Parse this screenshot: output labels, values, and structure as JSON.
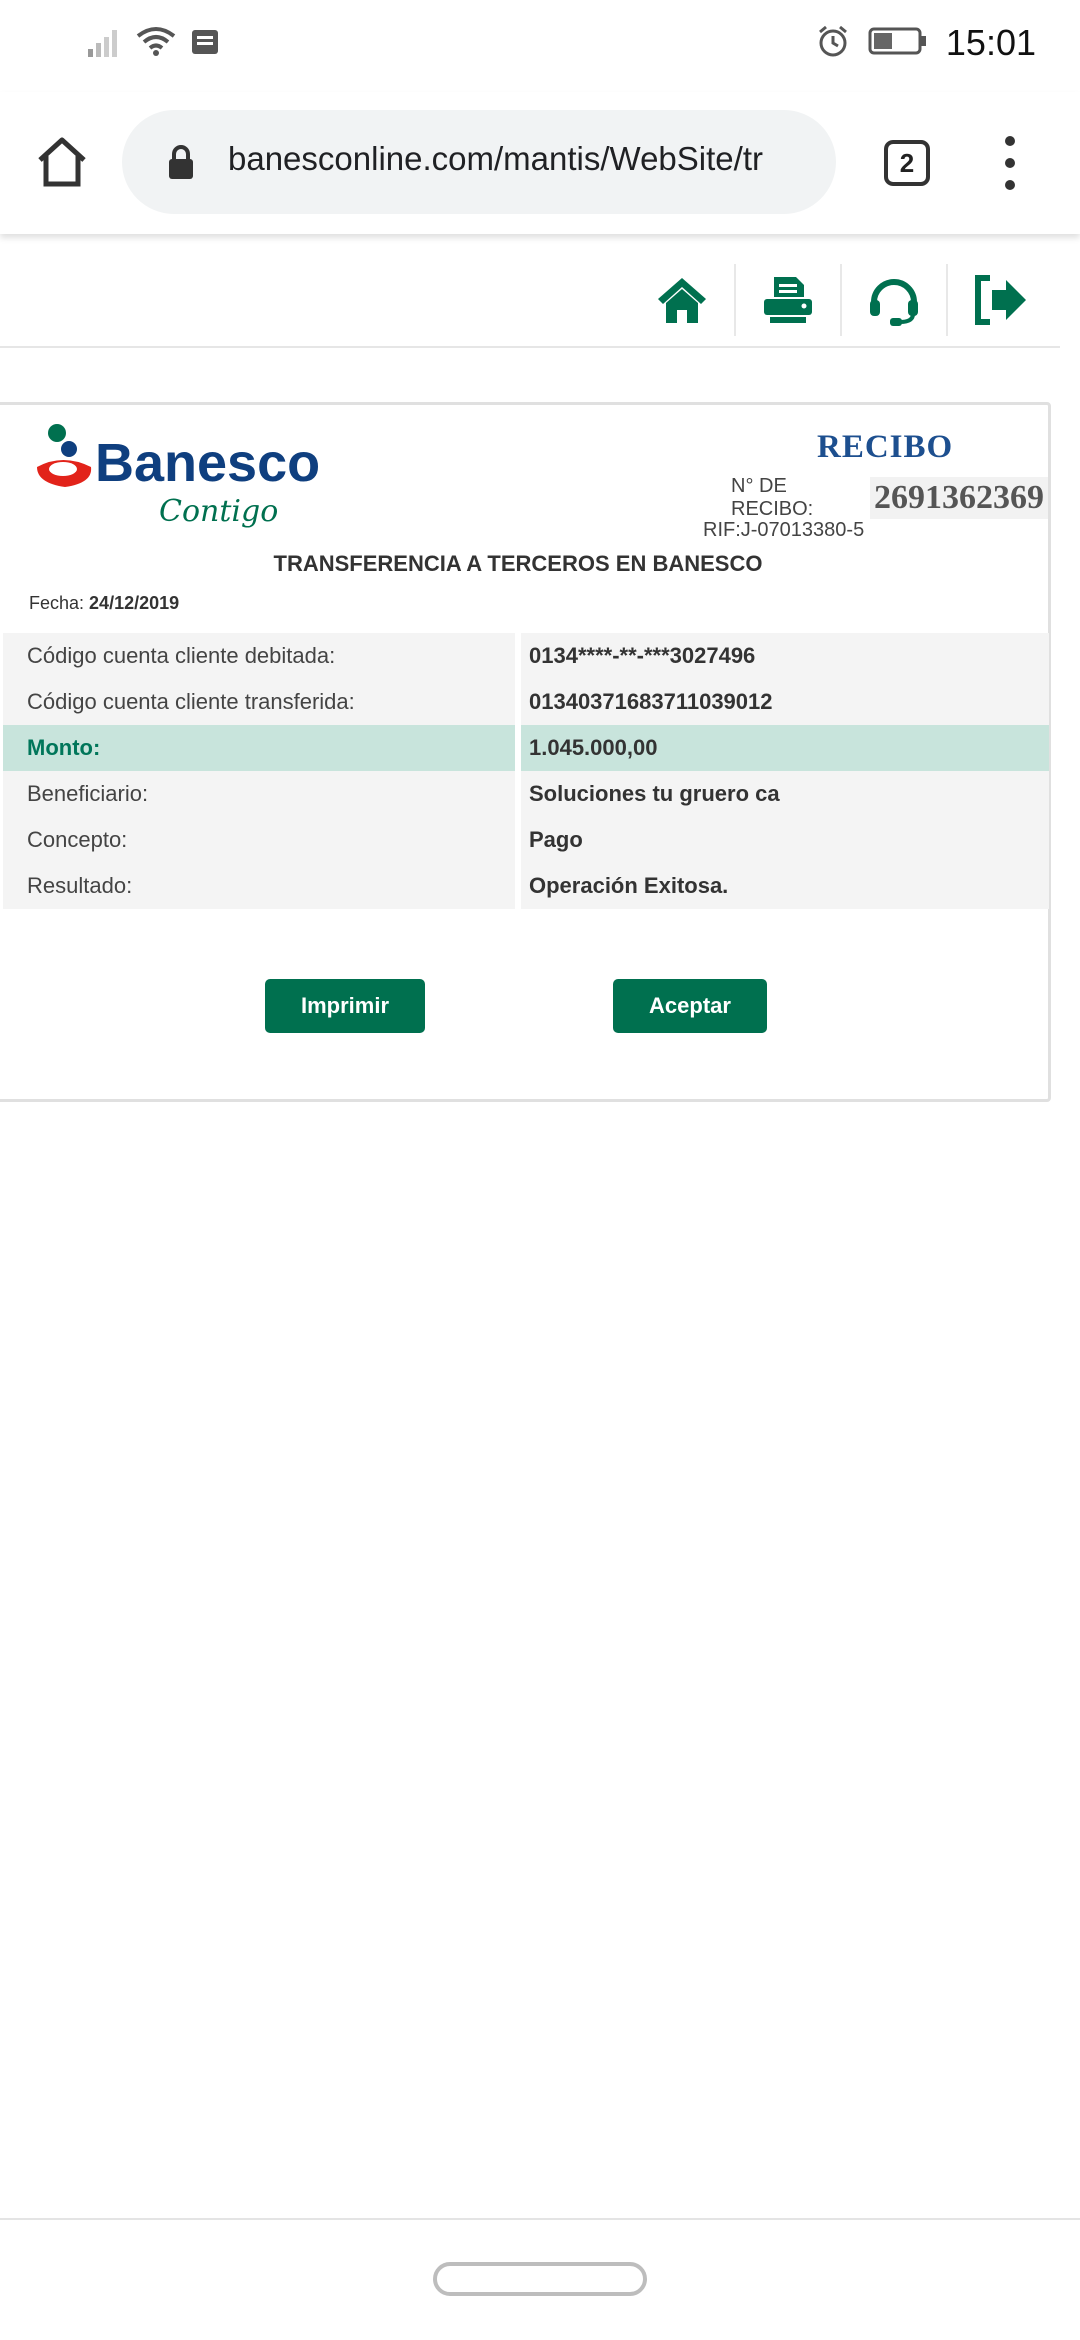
{
  "status_bar": {
    "time": "15:01",
    "icons": [
      "signal-icon",
      "wifi-icon",
      "notification-icon",
      "alarm-icon",
      "battery-icon"
    ]
  },
  "browser": {
    "url": "banesconline.com/mantis/WebSite/tr",
    "tab_count": "2",
    "icons": [
      "home-icon",
      "lock-icon",
      "menu-icon"
    ]
  },
  "toolbar": {
    "icons": [
      "home-icon",
      "printer-icon",
      "support-headset-icon",
      "logout-icon"
    ],
    "accent_color": "#00704f"
  },
  "receipt": {
    "bank_name": "Banesco",
    "bank_tagline": "Contigo",
    "title": "RECIBO",
    "number_label": "N° DE RECIBO:",
    "number": "2691362369",
    "rif": "RIF:J-07013380-5",
    "transaction_title": "TRANSFERENCIA A TERCEROS EN BANESCO",
    "date_label": "Fecha:",
    "date": "24/12/2019",
    "rows": [
      {
        "label": "Código cuenta cliente debitada:",
        "value": "0134****-**-***3027496"
      },
      {
        "label": "Código cuenta cliente transferida:",
        "value": "01340371683711039012"
      },
      {
        "label": "Monto:",
        "value": "1.045.000,00"
      },
      {
        "label": "Beneficiario:",
        "value": "Soluciones tu gruero ca"
      },
      {
        "label": "Concepto:",
        "value": "Pago"
      },
      {
        "label": "Resultado:",
        "value": "Operación Exitosa."
      }
    ],
    "print_button": "Imprimir",
    "accept_button": "Aceptar"
  }
}
